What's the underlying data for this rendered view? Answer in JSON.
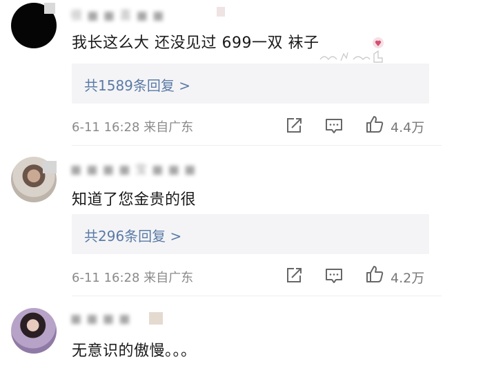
{
  "comments": [
    {
      "username": "很 ■ ■ 喜 ■ ■",
      "text": "我长这么大 还没见过 699一双 袜子",
      "reply_summary": "共1589条回复 >",
      "time_location": "6-11 16:28 来自广东",
      "likes": "4.4万"
    },
    {
      "username": "■ ■ ■ ■ 宝 ■ ■ ■",
      "text": "知道了您金贵的很",
      "reply_summary": "共296条回复 >",
      "time_location": "6-11 16:28 来自广东",
      "likes": "4.2万"
    },
    {
      "username": "■ ■ ■ ■",
      "text": "无意识的傲慢。。。"
    }
  ],
  "icons": {
    "share": "share-icon",
    "comment": "comment-icon",
    "like": "thumbs-up-icon"
  },
  "colors": {
    "reply_link": "#5a7aa6",
    "meta_text": "#8a8a8a",
    "reply_bg": "#f4f4f6"
  }
}
